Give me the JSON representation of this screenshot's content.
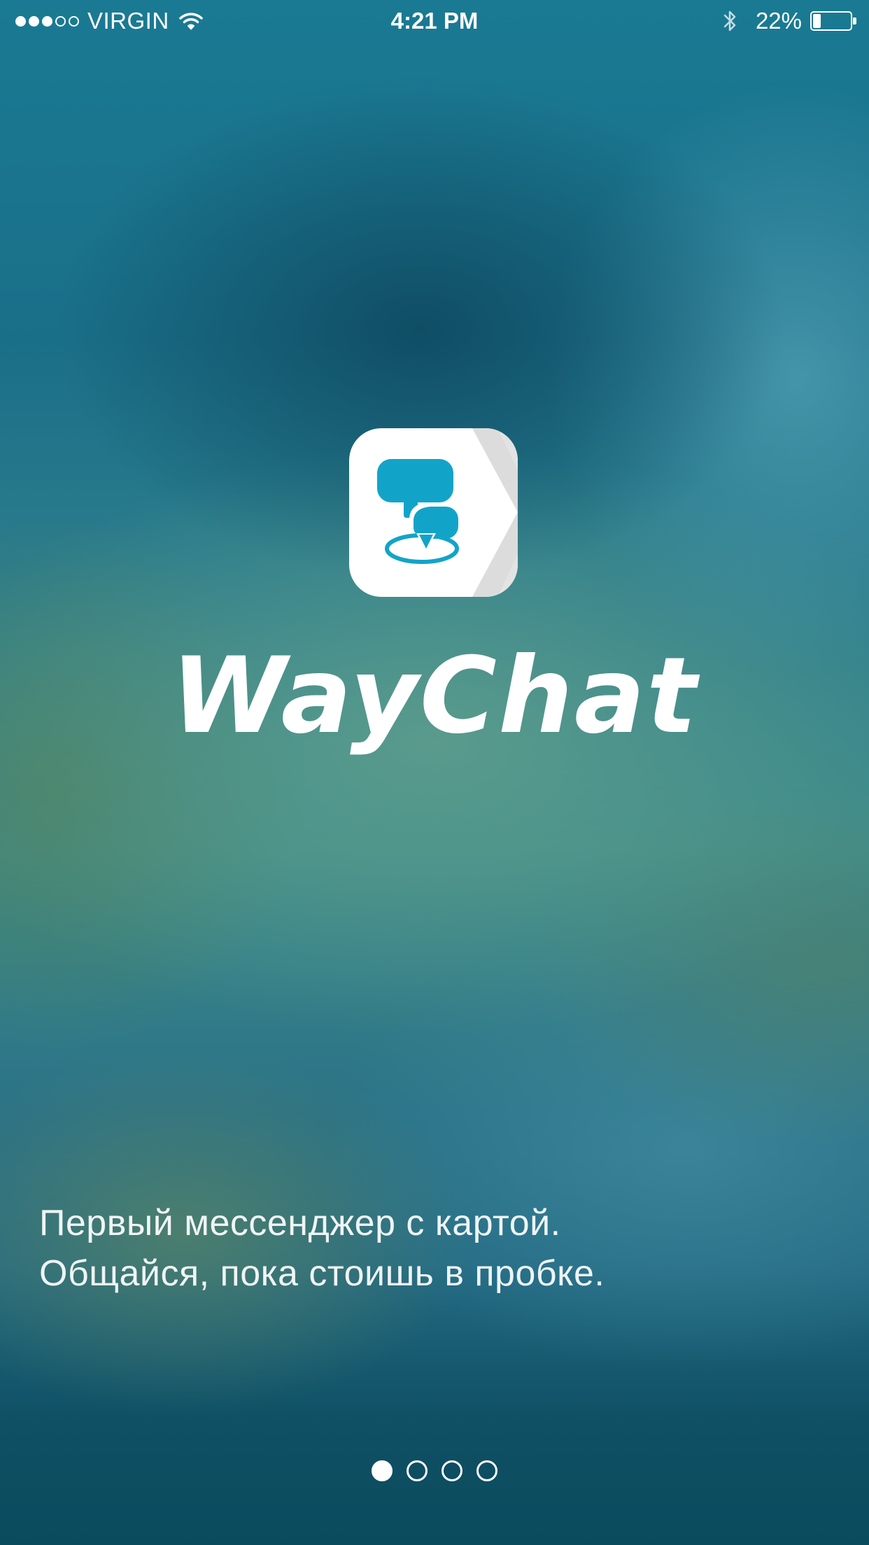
{
  "status_bar": {
    "carrier": "VIRGIN",
    "signal_bars": 5,
    "signal_filled": 3,
    "time": "4:21 PM",
    "battery_text": "22%",
    "battery_level": 0.22,
    "icons": [
      "wifi-icon",
      "bluetooth-icon",
      "battery-icon"
    ]
  },
  "app": {
    "name": "WayChat",
    "logo_icon": "chat-bubbles-location-icon",
    "accent_color": "#12a4c8"
  },
  "tagline": {
    "line1": "Первый мессенджер с картой.",
    "line2": "Общайся, пока стоишь в пробке."
  },
  "pagination": {
    "total": 4,
    "current": 1
  }
}
